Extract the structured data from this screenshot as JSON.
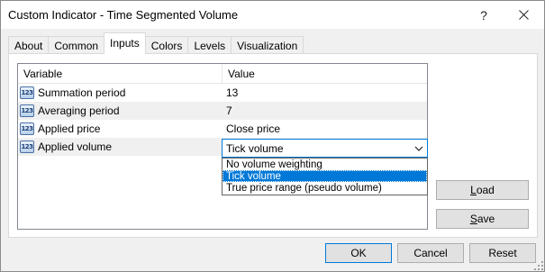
{
  "window": {
    "title": "Custom Indicator - Time Segmented Volume",
    "help_glyph": "?"
  },
  "tabs": [
    {
      "label": "About",
      "active": false
    },
    {
      "label": "Common",
      "active": false
    },
    {
      "label": "Inputs",
      "active": true
    },
    {
      "label": "Colors",
      "active": false
    },
    {
      "label": "Levels",
      "active": false
    },
    {
      "label": "Visualization",
      "active": false
    }
  ],
  "grid": {
    "columns": [
      "Variable",
      "Value"
    ],
    "icon_text": "123",
    "rows": [
      {
        "name": "Summation period",
        "value": "13"
      },
      {
        "name": "Averaging period",
        "value": "7"
      },
      {
        "name": "Applied price",
        "value": "Close price"
      },
      {
        "name": "Applied volume",
        "value": "Tick volume"
      }
    ]
  },
  "dropdown": {
    "selected": "Tick volume",
    "options": [
      "No volume weighting",
      "Tick volume",
      "True price range (pseudo volume)"
    ]
  },
  "buttons": {
    "load": {
      "pre": "",
      "mnemonic": "L",
      "post": "oad"
    },
    "save": {
      "pre": "",
      "mnemonic": "S",
      "post": "ave"
    },
    "ok": "OK",
    "cancel": "Cancel",
    "reset": "Reset"
  },
  "colors": {
    "accent": "#0078d7",
    "row_alt": "#f0f0f0",
    "dialog_bg": "#f0f0f0"
  }
}
